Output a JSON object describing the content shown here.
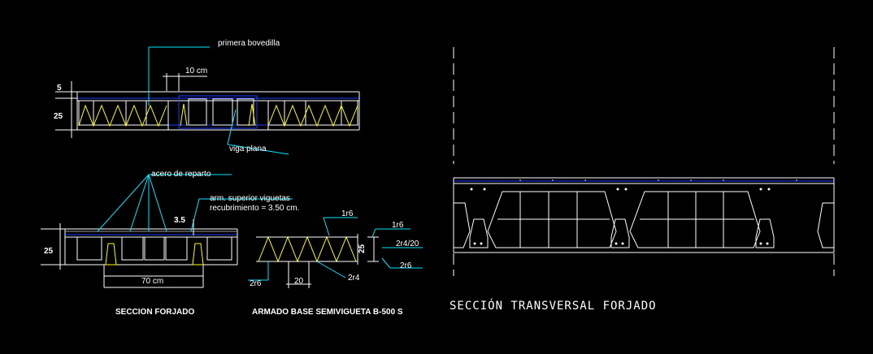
{
  "drawing": {
    "background": "#000000",
    "colors": {
      "white": "#ffffff",
      "cyan": "#00e5ff",
      "yellow": "#ffff00",
      "blue": "#1f3cff",
      "grey": "#9a9a9a"
    }
  },
  "section_forjado": {
    "label_bovedilla": "primera bovedilla",
    "label_10cm": "10 cm",
    "label_5": "5",
    "label_25": "25",
    "label_viga": "viga plana"
  },
  "detail_forjado": {
    "label_acero": "acero de reparto",
    "label_arm": "arm. superior viguetas",
    "label_recub": "recubrimiento = 3.50 cm.",
    "label_35": "3.5",
    "label_25": "25",
    "label_70": "70 cm",
    "title": "SECCION FORJADO"
  },
  "armado": {
    "label_1r6_top": "1r6",
    "label_1r6_right": "1r6",
    "label_25": "25",
    "label_2r4_20": "2r4/20",
    "label_2r6_right": "2r6",
    "label_2r6_left": "2r6",
    "label_20": "20",
    "label_2r4": "2r4",
    "title": "ARMADO BASE SEMIVIGUETA B-500 S"
  },
  "transversal": {
    "title": "SECCIÓN TRANSVERSAL FORJADO"
  }
}
